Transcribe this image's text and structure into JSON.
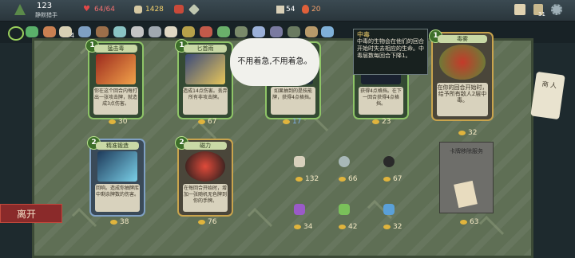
{
  "topbar": {
    "floor": "123",
    "character": "静默猎手",
    "hp": "64/64",
    "gold": "1428",
    "deck": "54",
    "seed": "20",
    "cards": "31"
  },
  "relics": {
    "count_badge": "4"
  },
  "speech": "不用着急,不用着急。",
  "tooltip": {
    "title": "中毒",
    "body": "中毒的生物会在他们的回合开始时失去相应的生命。中毒层数每回合下降1。"
  },
  "merchant_sign": "商 人",
  "leave": "离开",
  "cards_row1": [
    {
      "name": "猛击毒",
      "cost": "1",
      "desc": "你在这个回合内每打出一张攻击牌，就造成3点伤害。",
      "price": "30"
    },
    {
      "name": "匕首雨",
      "cost": "1",
      "desc": "造成14点伤害。丢弃所有非攻击牌。",
      "price": "67"
    },
    {
      "name": "…",
      "cost": "",
      "desc": "如果抽到的是技能牌，获得4点格挡。",
      "price": "17"
    },
    {
      "name": "…",
      "cost": "",
      "desc": "获得4点格挡。在下一回合获得4点格挡。",
      "price": "23"
    },
    {
      "name": "毒雾",
      "cost": "1",
      "desc": "在你的回合开始时，给予所有敌人2层中毒。",
      "price": "32"
    }
  ],
  "cards_row2": [
    {
      "name": "精准锻造",
      "cost": "2",
      "desc": "回响。造成你抽牌库中剩余牌数的伤害。",
      "price": "38"
    },
    {
      "name": "磁力",
      "cost": "2",
      "desc": "在每回合开始时，增加一张随机无色牌到你的手牌。",
      "price": "76"
    }
  ],
  "items": [
    {
      "name": "relic-scroll",
      "price": "132"
    },
    {
      "name": "relic-stone",
      "price": "66"
    },
    {
      "name": "relic-skull",
      "price": "67"
    },
    {
      "name": "potion-purple",
      "price": "34"
    },
    {
      "name": "potion-green",
      "price": "42"
    },
    {
      "name": "potion-blue",
      "price": "32"
    }
  ],
  "remove": {
    "title": "卡牌移除服务",
    "price": "63"
  }
}
